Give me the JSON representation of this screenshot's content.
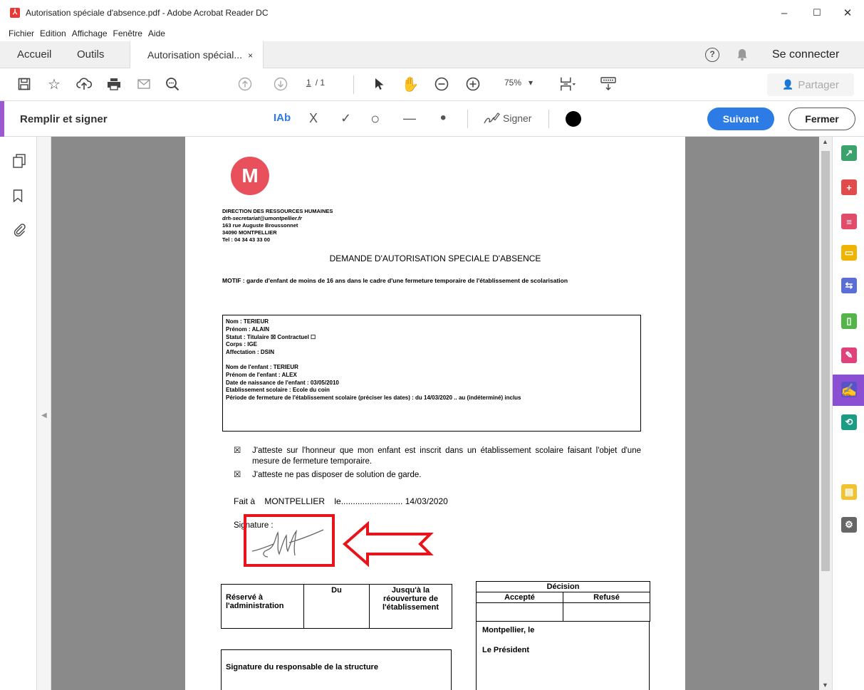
{
  "window": {
    "title": "Autorisation spéciale d'absence.pdf - Adobe Acrobat Reader DC",
    "minimize": "–",
    "maximize": "☐",
    "close": "✕"
  },
  "menu": [
    "Fichier",
    "Edition",
    "Affichage",
    "Fenêtre",
    "Aide"
  ],
  "tabs": {
    "home": "Accueil",
    "tools": "Outils",
    "document": "Autorisation spécial...",
    "close": "×"
  },
  "header": {
    "help": "?",
    "sign_in": "Se connecter"
  },
  "toolbar": {
    "page_current": "1",
    "page_total": "/ 1",
    "zoom": "75%",
    "zoom_caret": "▾",
    "share": "Partager"
  },
  "fill_sign": {
    "title": "Remplir et signer",
    "text_tool": "IAb",
    "cross": "X",
    "check": "✓",
    "circle": "○",
    "line": "—",
    "dot": "•",
    "sign": "Signer",
    "next": "Suivant",
    "close": "Fermer",
    "ink_color": "#000000"
  },
  "document": {
    "logo_letter": "M",
    "header_lines": [
      "DIRECTION DES RESSOURCES HUMAINES",
      "drh-secretariat@umontpellier.fr",
      "163 rue Auguste Broussonnet",
      "34090 MONTPELLIER",
      "Tel : 04 34 43 33 00"
    ],
    "title": "DEMANDE D'AUTORISATION SPECIALE D'ABSENCE",
    "motif": "MOTIF : garde d'enfant de moins de 16 ans dans le cadre d'une fermeture temporaire de l'établissement de scolarisation",
    "agent": {
      "nom": "Nom : TERIEUR",
      "prenom": "Prénom : ALAIN",
      "statut": "Statut : Titulaire ☒ Contractuel ☐",
      "corps": "Corps : IGE",
      "affectation": "Affectation : DSIN"
    },
    "enfant": {
      "nom": "Nom de l'enfant : TERIEUR",
      "prenom": "Prénom de l'enfant : ALEX",
      "naissance": "Date de naissance de l'enfant : 03/05/2010",
      "etablissement": "Etablissement scolaire : Ecole du coin",
      "periode": "Période de fermeture de l'établissement scolaire (préciser les dates) : du 14/03/2020 .. au (indéterminé) inclus"
    },
    "checkbox_mark": "☒",
    "attest1": "J'atteste sur l'honneur que mon enfant est inscrit dans un établissement scolaire faisant l'objet d'une mesure de fermeture temporaire.",
    "attest2": "J'atteste ne pas disposer de solution de garde.",
    "fait_a": "Fait à    MONTPELLIER    le.......................... 14/03/2020",
    "signature_label": "Signature :",
    "admin_table": {
      "reserve": "Réservé à l'administration",
      "du": "Du",
      "jusqua": "Jusqu'à la réouverture de l'établissement"
    },
    "decision": {
      "title": "Décision",
      "accepte": "Accepté",
      "refuse": "Refusé",
      "place": "Montpellier, le",
      "president": "Le Président"
    },
    "responsable": "Signature du responsable de la structure"
  },
  "colors": {
    "accent_purple": "#9b59d0",
    "primary_blue": "#2d7be5",
    "highlight_red": "#e8141b",
    "doc_bg": "#8a8a8a"
  }
}
